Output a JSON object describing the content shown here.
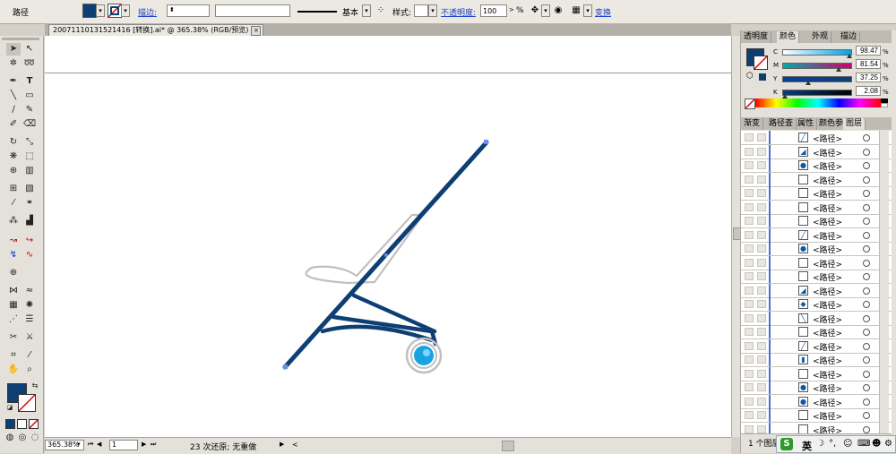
{
  "control_bar": {
    "object_type": "路径",
    "stroke_label": "描边:",
    "stroke_width": "",
    "brush_label": "基本",
    "style_label": "样式:",
    "opacity_label": "不透明度:",
    "opacity_value": "100",
    "opacity_unit": "%",
    "transform_label": "变换"
  },
  "document_tab": {
    "title": "20071110131521416 [转换].ai* @ 365.38% (RGB/预览)",
    "close": "×"
  },
  "status_bar": {
    "zoom": "365.38%",
    "page": "1",
    "message": "23 次还原; 无重做"
  },
  "color_panel": {
    "tabs": [
      "透明度",
      "颜色",
      "外观",
      "描边"
    ],
    "active_tab": "颜色",
    "channels": [
      {
        "label": "C",
        "value": "98.47",
        "pos": 0.98
      },
      {
        "label": "M",
        "value": "81.54",
        "pos": 0.82
      },
      {
        "label": "Y",
        "value": "37.25",
        "pos": 0.37
      },
      {
        "label": "K",
        "value": "2.08",
        "pos": 0.02
      }
    ],
    "percent": "%",
    "fill_color": "#0e3f74"
  },
  "layers_panel": {
    "tabs": [
      "渐变",
      "路径查",
      "属性",
      "颜色参",
      "图层"
    ],
    "active_tab": "图层",
    "rows": [
      {
        "name": "<路径>",
        "thumb": "╱"
      },
      {
        "name": "<路径>",
        "thumb": "◢"
      },
      {
        "name": "<路径>",
        "thumb": "●"
      },
      {
        "name": "<路径>",
        "thumb": ""
      },
      {
        "name": "<路径>",
        "thumb": ""
      },
      {
        "name": "<路径>",
        "thumb": ""
      },
      {
        "name": "<路径>",
        "thumb": ""
      },
      {
        "name": "<路径>",
        "thumb": "╱"
      },
      {
        "name": "<路径>",
        "thumb": "●"
      },
      {
        "name": "<路径>",
        "thumb": ""
      },
      {
        "name": "<路径>",
        "thumb": ""
      },
      {
        "name": "<路径>",
        "thumb": "◢"
      },
      {
        "name": "<路径>",
        "thumb": "◆"
      },
      {
        "name": "<路径>",
        "thumb": "╲"
      },
      {
        "name": "<路径>",
        "thumb": ""
      },
      {
        "name": "<路径>",
        "thumb": "╱"
      },
      {
        "name": "<路径>",
        "thumb": "▮"
      },
      {
        "name": "<路径>",
        "thumb": ""
      },
      {
        "name": "<路径>",
        "thumb": "●"
      },
      {
        "name": "<路径>",
        "thumb": "●"
      },
      {
        "name": "<路径>",
        "thumb": ""
      },
      {
        "name": "<路径>",
        "thumb": ""
      }
    ],
    "footer": "1 个图层"
  },
  "ime": {
    "lang": "英"
  },
  "colors": {
    "navy": "#0e3f74",
    "gray_stroke": "#c0c0c0",
    "cyan": "#1aa3e0"
  }
}
